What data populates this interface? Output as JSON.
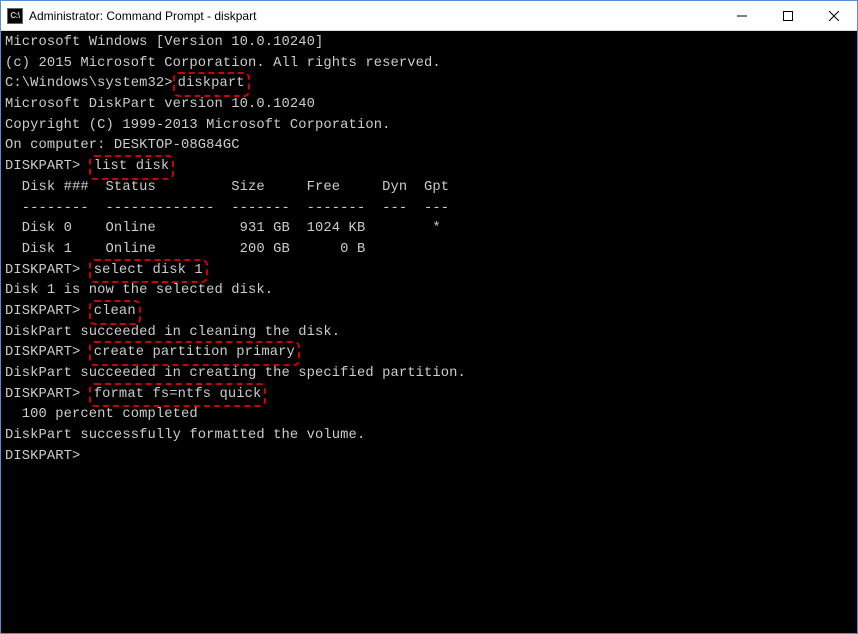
{
  "window": {
    "title": "Administrator: Command Prompt - diskpart",
    "icon_label": "C:\\"
  },
  "terminal": {
    "line1": "Microsoft Windows [Version 10.0.10240]",
    "line2": "(c) 2015 Microsoft Corporation. All rights reserved.",
    "blank": "",
    "prompt1_prefix": "C:\\Windows\\system32>",
    "cmd_diskpart": "diskpart",
    "dp_version": "Microsoft DiskPart version 10.0.10240",
    "copyright": "Copyright (C) 1999-2013 Microsoft Corporation.",
    "oncomputer": "On computer: DESKTOP-08G84GC",
    "dp_prompt": "DISKPART> ",
    "cmd_listdisk": "list disk",
    "tbl_header": "  Disk ###  Status         Size     Free     Dyn  Gpt",
    "tbl_divider": "  --------  -------------  -------  -------  ---  ---",
    "tbl_row0": "  Disk 0    Online          931 GB  1024 KB        *",
    "tbl_row1": "  Disk 1    Online          200 GB      0 B",
    "cmd_select": "select disk 1",
    "msg_selected": "Disk 1 is now the selected disk.",
    "cmd_clean": "clean",
    "msg_clean": "DiskPart succeeded in cleaning the disk.",
    "cmd_create": "create partition primary",
    "msg_create": "DiskPart succeeded in creating the specified partition.",
    "cmd_format": "format fs=ntfs quick",
    "msg_progress": "  100 percent completed",
    "msg_format": "DiskPart successfully formatted the volume.",
    "final_prompt": "DISKPART>"
  }
}
